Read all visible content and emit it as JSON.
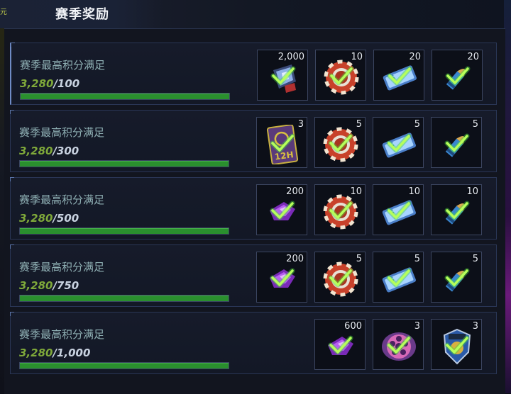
{
  "header": {
    "title": "赛季奖励",
    "corner_text": "元"
  },
  "rows": [
    {
      "label": "赛季最高积分满足",
      "current": "3,280",
      "target": "/100",
      "progress_fraction": 1.0,
      "rewards": [
        {
          "icon": "crystal-chest-icon",
          "qty": "2,000",
          "claimed": true
        },
        {
          "icon": "poker-chip-icon",
          "qty": "10",
          "claimed": true
        },
        {
          "icon": "ticket-icon",
          "qty": "20",
          "claimed": true
        },
        {
          "icon": "bullet-icon",
          "qty": "20",
          "claimed": true
        }
      ]
    },
    {
      "label": "赛季最高积分满足",
      "current": "3,280",
      "target": "/300",
      "progress_fraction": 1.0,
      "rewards": [
        {
          "icon": "12h-card-icon",
          "qty": "3",
          "claimed": true,
          "card_text": "12H"
        },
        {
          "icon": "poker-chip-icon",
          "qty": "5",
          "claimed": true
        },
        {
          "icon": "ticket-icon",
          "qty": "5",
          "claimed": true
        },
        {
          "icon": "bullet-icon",
          "qty": "5",
          "claimed": true
        }
      ]
    },
    {
      "label": "赛季最高积分满足",
      "current": "3,280",
      "target": "/500",
      "progress_fraction": 1.0,
      "rewards": [
        {
          "icon": "purple-gem-icon",
          "qty": "200",
          "claimed": true
        },
        {
          "icon": "poker-chip-icon",
          "qty": "10",
          "claimed": true
        },
        {
          "icon": "ticket-icon",
          "qty": "10",
          "claimed": true
        },
        {
          "icon": "bullet-icon",
          "qty": "10",
          "claimed": true
        }
      ]
    },
    {
      "label": "赛季最高积分满足",
      "current": "3,280",
      "target": "/750",
      "progress_fraction": 1.0,
      "rewards": [
        {
          "icon": "purple-gem-icon",
          "qty": "200",
          "claimed": true
        },
        {
          "icon": "poker-chip-icon",
          "qty": "5",
          "claimed": true
        },
        {
          "icon": "ticket-icon",
          "qty": "5",
          "claimed": true
        },
        {
          "icon": "bullet-icon",
          "qty": "5",
          "claimed": true
        }
      ]
    },
    {
      "label": "赛季最高积分满足",
      "current": "3,280",
      "target": "/1,000",
      "progress_fraction": 1.0,
      "rewards": [
        {
          "icon": "purple-gem-icon",
          "qty": "600",
          "claimed": true
        },
        {
          "icon": "film-reel-icon",
          "qty": "3",
          "claimed": true
        },
        {
          "icon": "police-badge-icon",
          "qty": "3",
          "claimed": true
        }
      ]
    }
  ],
  "colors": {
    "progress": "#2a8f2e",
    "current_value": "#7fa93a",
    "check": "#9cff3a",
    "label": "#8fb0b4"
  }
}
